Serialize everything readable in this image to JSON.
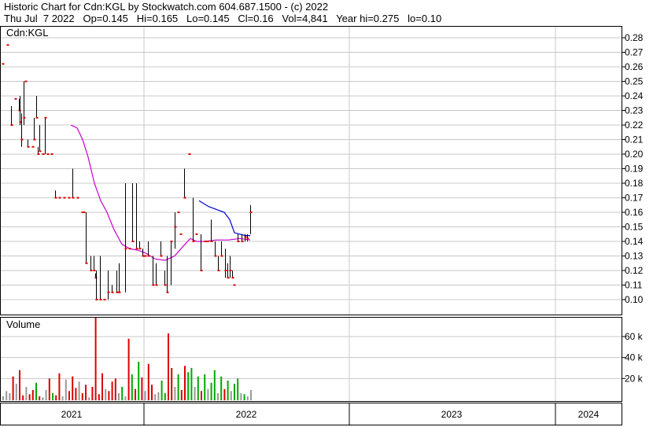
{
  "header": {
    "line1": "Historic Chart for Cdn:KGL by Stockwatch.com 604.687.1500 - (c) 2022",
    "line2": "Thu Jul  7 2022   Op=0.145   Hi=0.165   Lo=0.145   Cl=0.16   Vol=4,841   Year hi=0.275   lo=0.10"
  },
  "chart_data": [
    {
      "type": "ohlc",
      "title": "Cdn:KGL",
      "ylim": [
        0.09,
        0.285
      ],
      "y_ticks": [
        "0.28",
        "0.27",
        "0.26",
        "0.25",
        "0.24",
        "0.23",
        "0.22",
        "0.21",
        "0.20",
        "0.19",
        "0.18",
        "0.17",
        "0.16",
        "0.15",
        "0.14",
        "0.13",
        "0.12",
        "0.11",
        "0.10"
      ],
      "x_years": [
        "2021",
        "2022",
        "2023",
        "2024"
      ],
      "grid": true,
      "colors": {
        "price_bar": "#000000",
        "close_tick": "#dd0000",
        "ma_long": "#cc00cc",
        "ma_short": "#0000cc",
        "grid": "#c8c8c8"
      },
      "bars": [
        [
          0.262,
          0.262,
          0.262,
          0.262
        ],
        [
          0.275,
          0.275,
          0.275,
          0.275
        ],
        [
          0.233,
          0.233,
          0.22,
          0.22
        ],
        [
          0.238,
          0.238,
          0.238,
          0.238
        ],
        [
          0.238,
          0.238,
          0.23,
          0.23
        ],
        [
          0.24,
          0.24,
          0.22,
          0.222
        ],
        [
          0.228,
          0.228,
          0.205,
          0.21
        ],
        [
          0.25,
          0.25,
          0.22,
          0.225
        ],
        [
          0.25,
          0.25,
          0.25,
          0.25
        ],
        [
          0.21,
          0.21,
          0.205,
          0.205
        ],
        [
          0.205,
          0.205,
          0.205,
          0.205
        ],
        [
          0.225,
          0.225,
          0.21,
          0.21
        ],
        [
          0.24,
          0.24,
          0.225,
          0.225
        ],
        [
          0.205,
          0.205,
          0.2,
          0.2
        ],
        [
          0.22,
          0.22,
          0.202,
          0.202
        ],
        [
          0.2,
          0.2,
          0.2,
          0.2
        ],
        [
          0.225,
          0.225,
          0.2,
          0.225
        ],
        [
          0.2,
          0.2,
          0.2,
          0.2
        ],
        [
          0.2,
          0.2,
          0.2,
          0.2
        ],
        [
          0.175,
          0.175,
          0.17,
          0.17
        ],
        [
          0.17,
          0.17,
          0.17,
          0.17
        ],
        [
          0.17,
          0.17,
          0.17,
          0.17
        ],
        [
          0.17,
          0.17,
          0.17,
          0.17
        ],
        [
          0.19,
          0.19,
          0.17,
          0.17
        ],
        [
          0.17,
          0.17,
          0.17,
          0.17
        ],
        [
          0.16,
          0.16,
          0.16,
          0.16
        ],
        [
          0.16,
          0.16,
          0.16,
          0.16
        ],
        [
          0.16,
          0.16,
          0.125,
          0.125
        ],
        [
          0.13,
          0.13,
          0.12,
          0.12
        ],
        [
          0.13,
          0.13,
          0.12,
          0.12
        ],
        [
          0.118,
          0.118,
          0.115,
          0.115
        ],
        [
          0.12,
          0.12,
          0.1,
          0.1
        ],
        [
          0.13,
          0.13,
          0.1,
          0.1
        ],
        [
          0.1,
          0.1,
          0.1,
          0.1
        ],
        [
          0.12,
          0.12,
          0.1,
          0.105
        ],
        [
          0.11,
          0.11,
          0.105,
          0.105
        ],
        [
          0.12,
          0.12,
          0.105,
          0.105
        ],
        [
          0.125,
          0.125,
          0.105,
          0.105
        ],
        [
          0.18,
          0.18,
          0.105,
          0.135
        ],
        [
          0.135,
          0.135,
          0.135,
          0.135
        ],
        [
          0.18,
          0.18,
          0.14,
          0.14
        ],
        [
          0.18,
          0.18,
          0.135,
          0.135
        ],
        [
          0.14,
          0.14,
          0.135,
          0.135
        ],
        [
          0.135,
          0.135,
          0.13,
          0.13
        ],
        [
          0.13,
          0.13,
          0.13,
          0.13
        ],
        [
          0.14,
          0.14,
          0.13,
          0.13
        ],
        [
          0.13,
          0.13,
          0.11,
          0.11
        ],
        [
          0.125,
          0.125,
          0.11,
          0.11
        ],
        [
          0.14,
          0.14,
          0.13,
          0.13
        ],
        [
          0.12,
          0.12,
          0.11,
          0.11
        ],
        [
          0.13,
          0.13,
          0.105,
          0.105
        ],
        [
          0.14,
          0.14,
          0.11,
          0.14
        ],
        [
          0.16,
          0.16,
          0.135,
          0.15
        ],
        [
          0.16,
          0.16,
          0.16,
          0.16
        ],
        [
          0.145,
          0.145,
          0.145,
          0.145
        ],
        [
          0.19,
          0.19,
          0.17,
          0.17
        ],
        [
          0.2,
          0.2,
          0.2,
          0.2
        ],
        [
          0.17,
          0.17,
          0.14,
          0.14
        ],
        [
          0.145,
          0.145,
          0.145,
          0.145
        ],
        [
          0.145,
          0.145,
          0.12,
          0.12
        ],
        [
          0.14,
          0.14,
          0.14,
          0.14
        ],
        [
          0.14,
          0.14,
          0.14,
          0.14
        ],
        [
          0.155,
          0.155,
          0.14,
          0.14
        ],
        [
          0.14,
          0.14,
          0.13,
          0.13
        ],
        [
          0.13,
          0.13,
          0.12,
          0.12
        ],
        [
          0.14,
          0.14,
          0.13,
          0.13
        ],
        [
          0.135,
          0.135,
          0.115,
          0.12
        ],
        [
          0.125,
          0.125,
          0.115,
          0.115
        ],
        [
          0.13,
          0.13,
          0.115,
          0.12
        ],
        [
          0.12,
          0.12,
          0.115,
          0.115
        ],
        [
          0.11,
          0.11,
          0.11,
          0.11
        ],
        [
          0.145,
          0.145,
          0.14,
          0.14
        ],
        [
          0.145,
          0.145,
          0.14,
          0.14
        ],
        [
          0.145,
          0.145,
          0.14,
          0.143
        ],
        [
          0.145,
          0.145,
          0.14,
          0.142
        ],
        [
          0.165,
          0.165,
          0.145,
          0.16
        ]
      ],
      "bar_day_index": [
        0,
        5,
        9,
        13,
        17,
        18,
        20,
        22,
        24,
        26,
        31,
        33,
        35,
        37,
        39,
        42,
        44,
        47,
        51,
        55,
        59,
        64,
        69,
        73,
        78,
        83,
        85,
        87,
        92,
        95,
        97,
        98,
        102,
        106,
        110,
        114,
        119,
        122,
        128,
        132,
        136,
        140,
        143,
        146,
        149,
        152,
        157,
        160,
        165,
        169,
        172,
        176,
        180,
        183,
        186,
        190,
        195,
        199,
        202,
        207,
        211,
        214,
        218,
        222,
        225,
        229,
        233,
        235,
        238,
        240,
        242,
        246,
        250,
        253,
        256,
        259
      ],
      "ma_long": [
        [
          0.22,
          90
        ],
        [
          0.218,
          98
        ],
        [
          0.21,
          105
        ],
        [
          0.198,
          112
        ],
        [
          0.18,
          120
        ],
        [
          0.168,
          128
        ],
        [
          0.16,
          136
        ],
        [
          0.148,
          145
        ],
        [
          0.138,
          155
        ],
        [
          0.135,
          165
        ],
        [
          0.134,
          175
        ],
        [
          0.132,
          185
        ],
        [
          0.128,
          197
        ],
        [
          0.127,
          210
        ],
        [
          0.13,
          222
        ],
        [
          0.138,
          235
        ],
        [
          0.142,
          242
        ],
        [
          0.14,
          250
        ],
        [
          0.14,
          260
        ],
        [
          0.141,
          275
        ],
        [
          0.141,
          290
        ],
        [
          0.142,
          305
        ],
        [
          0.141,
          318
        ]
      ],
      "ma_short": [
        [
          0.168,
          253
        ],
        [
          0.164,
          265
        ],
        [
          0.162,
          275
        ],
        [
          0.16,
          285
        ],
        [
          0.155,
          292
        ],
        [
          0.146,
          298
        ],
        [
          0.145,
          305
        ],
        [
          0.144,
          312
        ],
        [
          0.144,
          318
        ]
      ]
    },
    {
      "type": "bar",
      "title": "Volume",
      "y_ticks": [
        "60 k",
        "40 k",
        "20 k"
      ],
      "ylim": [
        0,
        80000
      ],
      "colors": {
        "up": "#00aa00",
        "down": "#dd0000",
        "flat": "#999999"
      },
      "values": [
        [
          3000,
          "flat"
        ],
        [
          8000,
          "flat"
        ],
        [
          6000,
          "flat"
        ],
        [
          22000,
          "down"
        ],
        [
          15000,
          "flat"
        ],
        [
          28000,
          "down"
        ],
        [
          4000,
          "down"
        ],
        [
          12000,
          "flat"
        ],
        [
          5000,
          "down"
        ],
        [
          9000,
          "down"
        ],
        [
          16000,
          "green"
        ],
        [
          3000,
          "down"
        ],
        [
          2000,
          "flat"
        ],
        [
          9000,
          "flat"
        ],
        [
          20000,
          "down"
        ],
        [
          6000,
          "green"
        ],
        [
          4000,
          "down"
        ],
        [
          25000,
          "down"
        ],
        [
          3000,
          "flat"
        ],
        [
          19000,
          "flat"
        ],
        [
          8000,
          "down"
        ],
        [
          22000,
          "down"
        ],
        [
          11000,
          "down"
        ],
        [
          17000,
          "flat"
        ],
        [
          6000,
          "down"
        ],
        [
          14000,
          "down"
        ],
        [
          2000,
          "flat"
        ],
        [
          12000,
          "down"
        ],
        [
          78000,
          "down"
        ],
        [
          5000,
          "down"
        ],
        [
          25000,
          "down"
        ],
        [
          10000,
          "flat"
        ],
        [
          8000,
          "down"
        ],
        [
          17000,
          "down"
        ],
        [
          20000,
          "down"
        ],
        [
          6000,
          "flat"
        ],
        [
          12000,
          "green"
        ],
        [
          3000,
          "flat"
        ],
        [
          58000,
          "down"
        ],
        [
          24000,
          "green"
        ],
        [
          10000,
          "down"
        ],
        [
          36000,
          "green"
        ],
        [
          21000,
          "down"
        ],
        [
          8000,
          "flat"
        ],
        [
          34000,
          "down"
        ],
        [
          14000,
          "down"
        ],
        [
          5000,
          "flat"
        ],
        [
          7000,
          "flat"
        ],
        [
          18000,
          "green"
        ],
        [
          6000,
          "green"
        ],
        [
          63000,
          "down"
        ],
        [
          30000,
          "down"
        ],
        [
          12000,
          "flat"
        ],
        [
          24000,
          "green"
        ],
        [
          9000,
          "down"
        ],
        [
          32000,
          "down"
        ],
        [
          26000,
          "green"
        ],
        [
          30000,
          "green"
        ],
        [
          12000,
          "flat"
        ],
        [
          22000,
          "green"
        ],
        [
          8000,
          "down"
        ],
        [
          24000,
          "green"
        ],
        [
          10000,
          "flat"
        ],
        [
          16000,
          "green"
        ],
        [
          28000,
          "green"
        ],
        [
          6000,
          "flat"
        ],
        [
          22000,
          "green"
        ],
        [
          10000,
          "down"
        ],
        [
          18000,
          "green"
        ],
        [
          8000,
          "flat"
        ],
        [
          15000,
          "green"
        ],
        [
          20000,
          "green"
        ],
        [
          6000,
          "flat"
        ],
        [
          5000,
          "green"
        ],
        [
          3000,
          "flat"
        ],
        [
          9000,
          "flat"
        ]
      ]
    }
  ]
}
